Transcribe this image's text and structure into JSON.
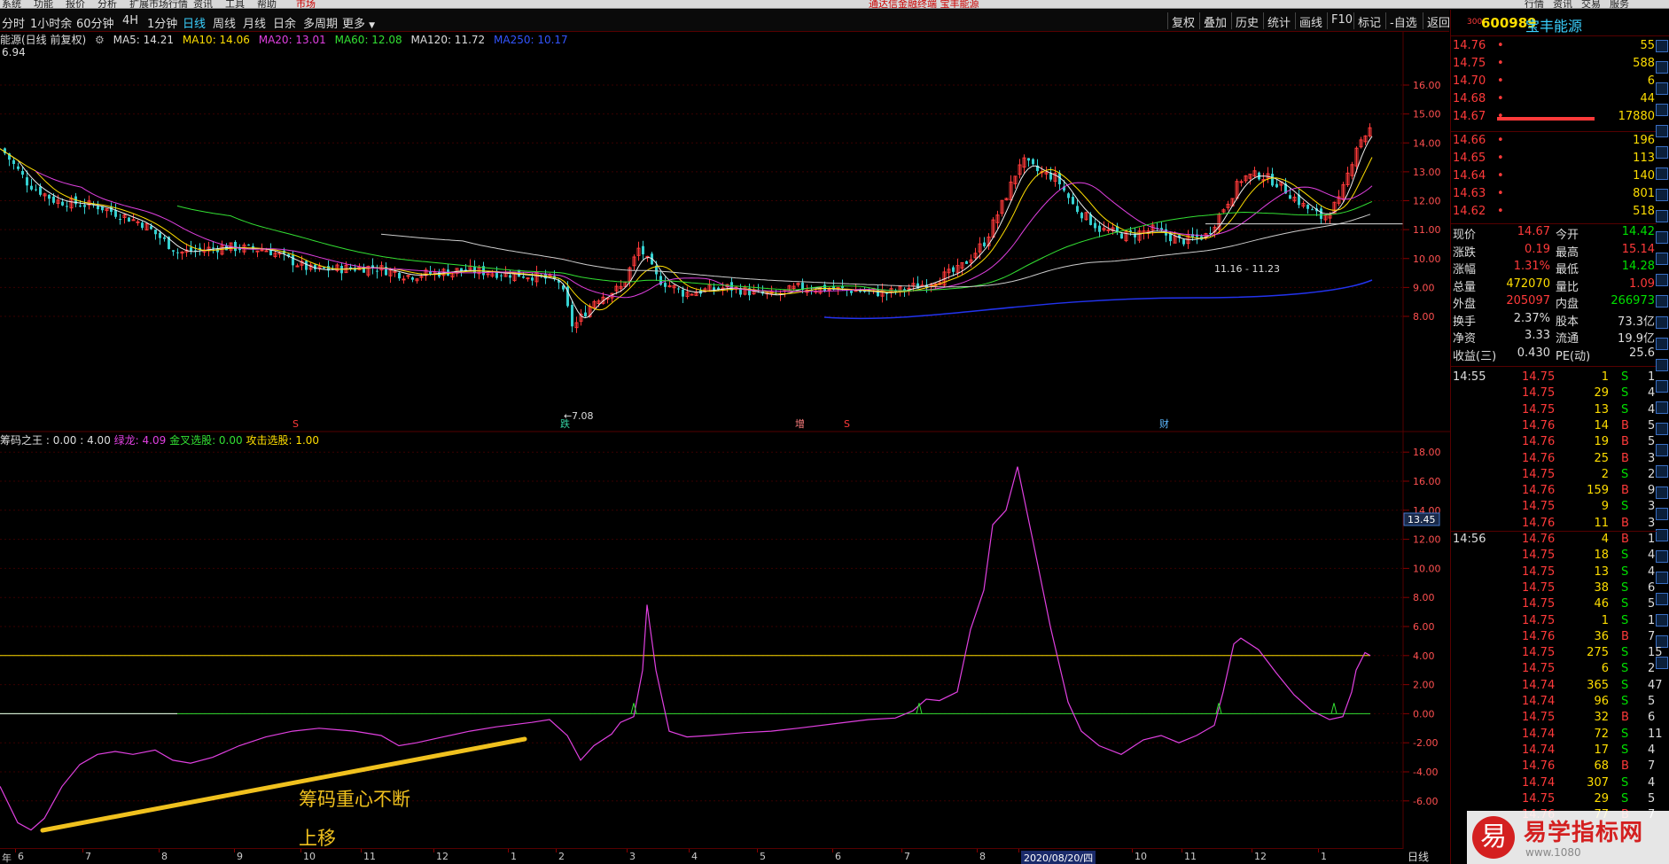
{
  "menu": {
    "items": [
      "系统",
      "功能",
      "报价",
      "分析",
      "扩展市场行情",
      "资讯",
      "工具",
      "帮助",
      "市场"
    ],
    "window_title": "通达信金融终端 宝丰能源",
    "right_buttons": [
      "行情",
      "资讯",
      "交易",
      "服务"
    ]
  },
  "toolbar": {
    "periods": [
      "分时",
      "1小时余",
      "60分钟",
      "4H",
      "1分钟",
      "日线",
      "周线",
      "月线",
      "日余",
      "多周期",
      "更多"
    ],
    "active": "日线",
    "right_buttons": [
      "复权",
      "叠加",
      "历史",
      "统计",
      "画线",
      "F10",
      "标记",
      "-自选",
      "返回"
    ]
  },
  "ma_line": {
    "name": "能源(日线 前复权)",
    "ma5": "MA5: 14.21",
    "ma10": "MA10: 14.06",
    "ma20": "MA20: 13.01",
    "ma60": "MA60: 12.08",
    "ma120": "MA120: 11.72",
    "ma250": "MA250: 10.17",
    "top_value": "6.94"
  },
  "main_chart": {
    "y_ticks": [
      "16.00",
      "15.00",
      "14.00",
      "13.00",
      "12.00",
      "11.00",
      "10.00",
      "9.00",
      "8.00"
    ],
    "low_label": "7.08",
    "range_label": "11.16 - 11.23",
    "events": [
      {
        "label": "S",
        "color": "#ff3a3a"
      },
      {
        "label": "跌",
        "color": "#33d1a0"
      },
      {
        "label": "增",
        "color": "#ff8080"
      },
      {
        "label": "S",
        "color": "#ff3a3a"
      },
      {
        "label": "财",
        "color": "#5cb8ff"
      }
    ]
  },
  "indicator": {
    "name": "筹码之王",
    "v1": ": 0.00",
    "v2": ": 4.00",
    "green_dragon": "绿龙: 4.09",
    "golden_cross": "金叉选股: 0.00",
    "attack": "攻击选股: 1.00",
    "y_ticks": [
      "18.00",
      "16.00",
      "14.00",
      "12.00",
      "10.00",
      "8.00",
      "6.00",
      "4.00",
      "2.00",
      "0.00",
      "-2.00",
      "-4.00",
      "-6.00"
    ],
    "current_marker": "13.45",
    "annotation_line1": "筹码重心不断",
    "annotation_line2": "上移"
  },
  "x_axis": {
    "labels": [
      "年",
      "6",
      "7",
      "8",
      "9",
      "10",
      "11",
      "12",
      "1",
      "2",
      "3",
      "4",
      "5",
      "6",
      "7",
      "8",
      "2020/08/20/四",
      "10",
      "11",
      "12",
      "1"
    ],
    "period_label": "日线"
  },
  "quote": {
    "code": "600989",
    "name": "宝丰能源",
    "prefix": "300",
    "asks": [
      {
        "price": "14.76",
        "vol": "55"
      },
      {
        "price": "14.75",
        "vol": "588"
      },
      {
        "price": "14.70",
        "vol": "6"
      },
      {
        "price": "14.68",
        "vol": "44"
      },
      {
        "price": "14.67",
        "vol": "17880"
      }
    ],
    "bids": [
      {
        "price": "14.66",
        "vol": "196"
      },
      {
        "price": "14.65",
        "vol": "113"
      },
      {
        "price": "14.64",
        "vol": "140"
      },
      {
        "price": "14.63",
        "vol": "801"
      },
      {
        "price": "14.62",
        "vol": "518"
      }
    ],
    "stats": [
      {
        "k1": "现价",
        "v1": "14.67",
        "c1": "#ff3a3a",
        "k2": "今开",
        "v2": "14.42",
        "c2": "#00e000"
      },
      {
        "k1": "涨跌",
        "v1": "0.19",
        "c1": "#ff3a3a",
        "k2": "最高",
        "v2": "15.14",
        "c2": "#ff3a3a"
      },
      {
        "k1": "涨幅",
        "v1": "1.31%",
        "c1": "#ff3a3a",
        "k2": "最低",
        "v2": "14.28",
        "c2": "#00e000"
      },
      {
        "k1": "总量",
        "v1": "472070",
        "c1": "#ffde00",
        "k2": "量比",
        "v2": "1.09",
        "c2": "#ff3a3a"
      },
      {
        "k1": "外盘",
        "v1": "205097",
        "c1": "#ff3a3a",
        "k2": "内盘",
        "v2": "266973",
        "c2": "#00e000"
      },
      {
        "k1": "换手",
        "v1": "2.37%",
        "c1": "#ddd",
        "k2": "股本",
        "v2": "73.3亿",
        "c2": "#ddd"
      },
      {
        "k1": "净资",
        "v1": "3.33",
        "c1": "#ddd",
        "k2": "流通",
        "v2": "19.9亿",
        "c2": "#ddd"
      },
      {
        "k1": "收益(三)",
        "v1": "0.430",
        "c1": "#ddd",
        "k2": "PE(动)",
        "v2": "25.6",
        "c2": "#ddd"
      }
    ],
    "ticks_time1": "14:55",
    "ticks_time2": "14:56",
    "ticks": [
      {
        "p": "14.75",
        "v": "1",
        "s": "S",
        "n": "1"
      },
      {
        "p": "14.75",
        "v": "29",
        "s": "S",
        "n": "4"
      },
      {
        "p": "14.75",
        "v": "13",
        "s": "S",
        "n": "4"
      },
      {
        "p": "14.76",
        "v": "14",
        "s": "B",
        "n": "5"
      },
      {
        "p": "14.76",
        "v": "19",
        "s": "B",
        "n": "5"
      },
      {
        "p": "14.76",
        "v": "25",
        "s": "B",
        "n": "3"
      },
      {
        "p": "14.75",
        "v": "2",
        "s": "S",
        "n": "2"
      },
      {
        "p": "14.76",
        "v": "159",
        "s": "B",
        "n": "9"
      },
      {
        "p": "14.75",
        "v": "9",
        "s": "S",
        "n": "3"
      },
      {
        "p": "14.76",
        "v": "11",
        "s": "B",
        "n": "3"
      },
      {
        "p": "14.76",
        "v": "4",
        "s": "B",
        "n": "1"
      },
      {
        "p": "14.75",
        "v": "18",
        "s": "S",
        "n": "4"
      },
      {
        "p": "14.75",
        "v": "13",
        "s": "S",
        "n": "4"
      },
      {
        "p": "14.75",
        "v": "38",
        "s": "S",
        "n": "6"
      },
      {
        "p": "14.75",
        "v": "46",
        "s": "S",
        "n": "5"
      },
      {
        "p": "14.75",
        "v": "1",
        "s": "S",
        "n": "1"
      },
      {
        "p": "14.76",
        "v": "36",
        "s": "B",
        "n": "7"
      },
      {
        "p": "14.75",
        "v": "275",
        "s": "S",
        "n": "15"
      },
      {
        "p": "14.75",
        "v": "6",
        "s": "S",
        "n": "2"
      },
      {
        "p": "14.74",
        "v": "365",
        "s": "S",
        "n": "47"
      },
      {
        "p": "14.74",
        "v": "96",
        "s": "S",
        "n": "5"
      },
      {
        "p": "14.75",
        "v": "32",
        "s": "B",
        "n": "6"
      },
      {
        "p": "14.74",
        "v": "72",
        "s": "S",
        "n": "11"
      },
      {
        "p": "14.74",
        "v": "17",
        "s": "S",
        "n": "4"
      },
      {
        "p": "14.76",
        "v": "68",
        "s": "B",
        "n": "7"
      },
      {
        "p": "14.74",
        "v": "307",
        "s": "S",
        "n": "4"
      },
      {
        "p": "14.75",
        "v": "29",
        "s": "S",
        "n": "5"
      },
      {
        "p": "14.76",
        "v": "77",
        "s": "B",
        "n": "7"
      }
    ]
  },
  "watermark": {
    "logo_char": "易",
    "site_name": "易学指标网",
    "site_url": "www.1080"
  }
}
